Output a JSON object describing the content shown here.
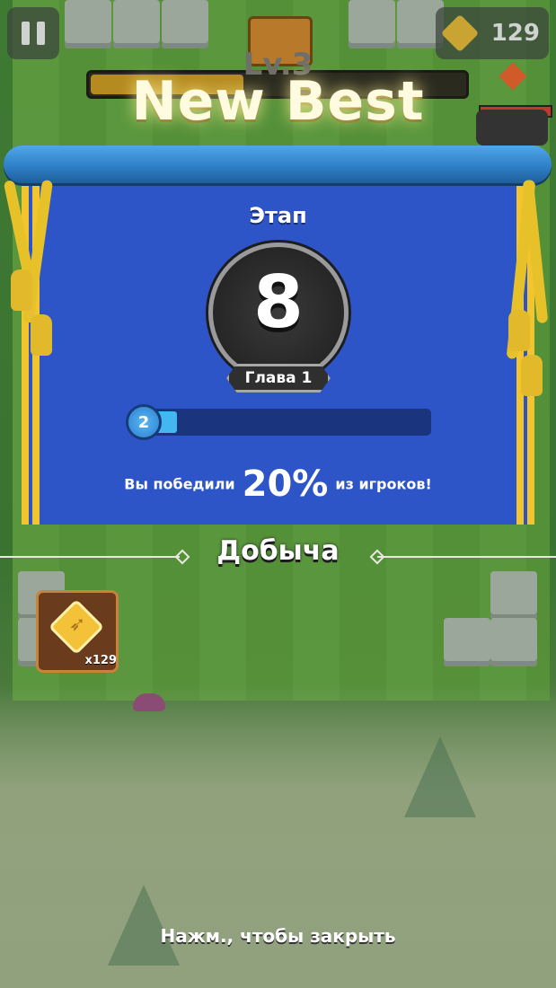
{
  "hud": {
    "coin_count": "129",
    "level_text": "Lv.3",
    "new_best_text": "New Best"
  },
  "result": {
    "stage_label": "Этап",
    "stage_number": "8",
    "chapter_label": "Глава 1",
    "player_level": "2",
    "xp_progress_fraction": 0.1,
    "beat_prefix": "Вы победили",
    "beat_percent": "20%",
    "beat_suffix": "из игроков!"
  },
  "loot": {
    "title": "Добыча",
    "items": [
      {
        "icon": "bow-coin-icon",
        "count": "x129"
      }
    ]
  },
  "footer": {
    "close_hint": "Нажм., чтобы закрыть"
  },
  "colors": {
    "banner_blue": "#2d55c8",
    "banner_gold": "#f2c52e",
    "xp_fill": "#43b7ef"
  }
}
